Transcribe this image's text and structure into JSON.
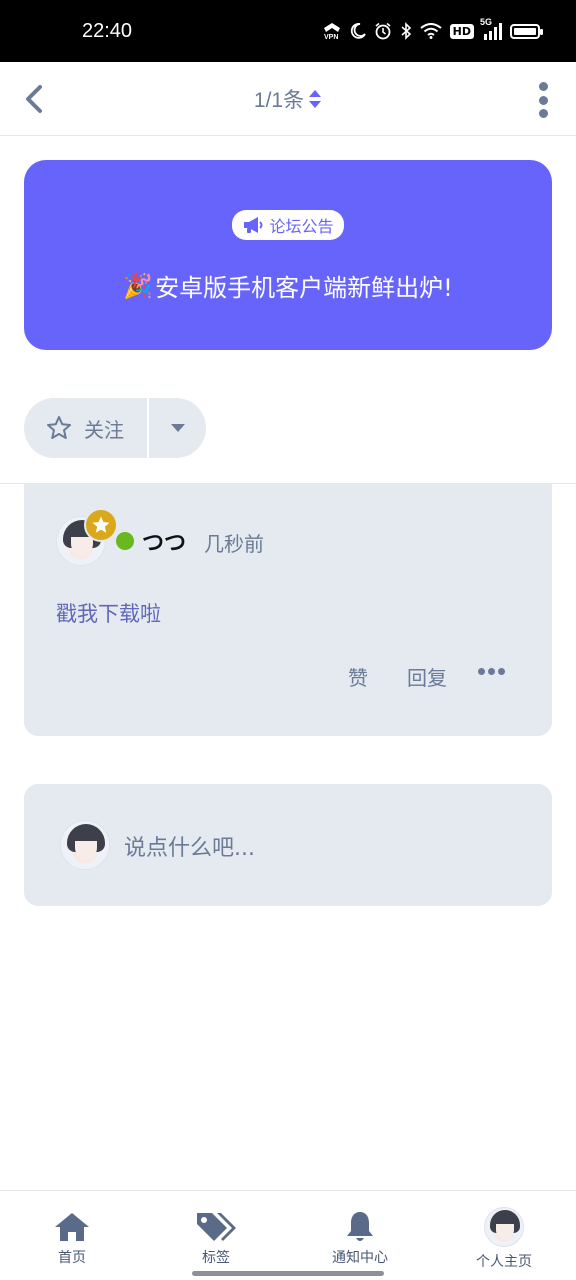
{
  "status_bar": {
    "time": "22:40",
    "icons": [
      "vpn-icon",
      "moon-icon",
      "alarm-icon",
      "bluetooth-icon",
      "wifi-icon",
      "hd-icon",
      "signal-5g-icon",
      "battery-icon"
    ],
    "hd_label": "HD",
    "network_label": "5G"
  },
  "top_nav": {
    "page_count": "1/1条"
  },
  "announcement": {
    "badge_label": "论坛公告",
    "emoji": "🎉",
    "text": "安卓版手机客户端新鲜出炉!",
    "background_color": "#6764fc"
  },
  "follow": {
    "label": "关注"
  },
  "post": {
    "username": "つつ",
    "time": "几秒前",
    "content": "戳我下载啦",
    "like_label": "赞",
    "reply_label": "回复",
    "online_color": "#69b81e",
    "badge_color": "#d9a91b"
  },
  "reply_box": {
    "placeholder": "说点什么吧..."
  },
  "bottom_nav": {
    "tabs": [
      {
        "label": "首页",
        "icon": "home-icon"
      },
      {
        "label": "标签",
        "icon": "tags-icon"
      },
      {
        "label": "通知中心",
        "icon": "bell-icon"
      },
      {
        "label": "个人主页",
        "icon": "avatar"
      }
    ]
  }
}
